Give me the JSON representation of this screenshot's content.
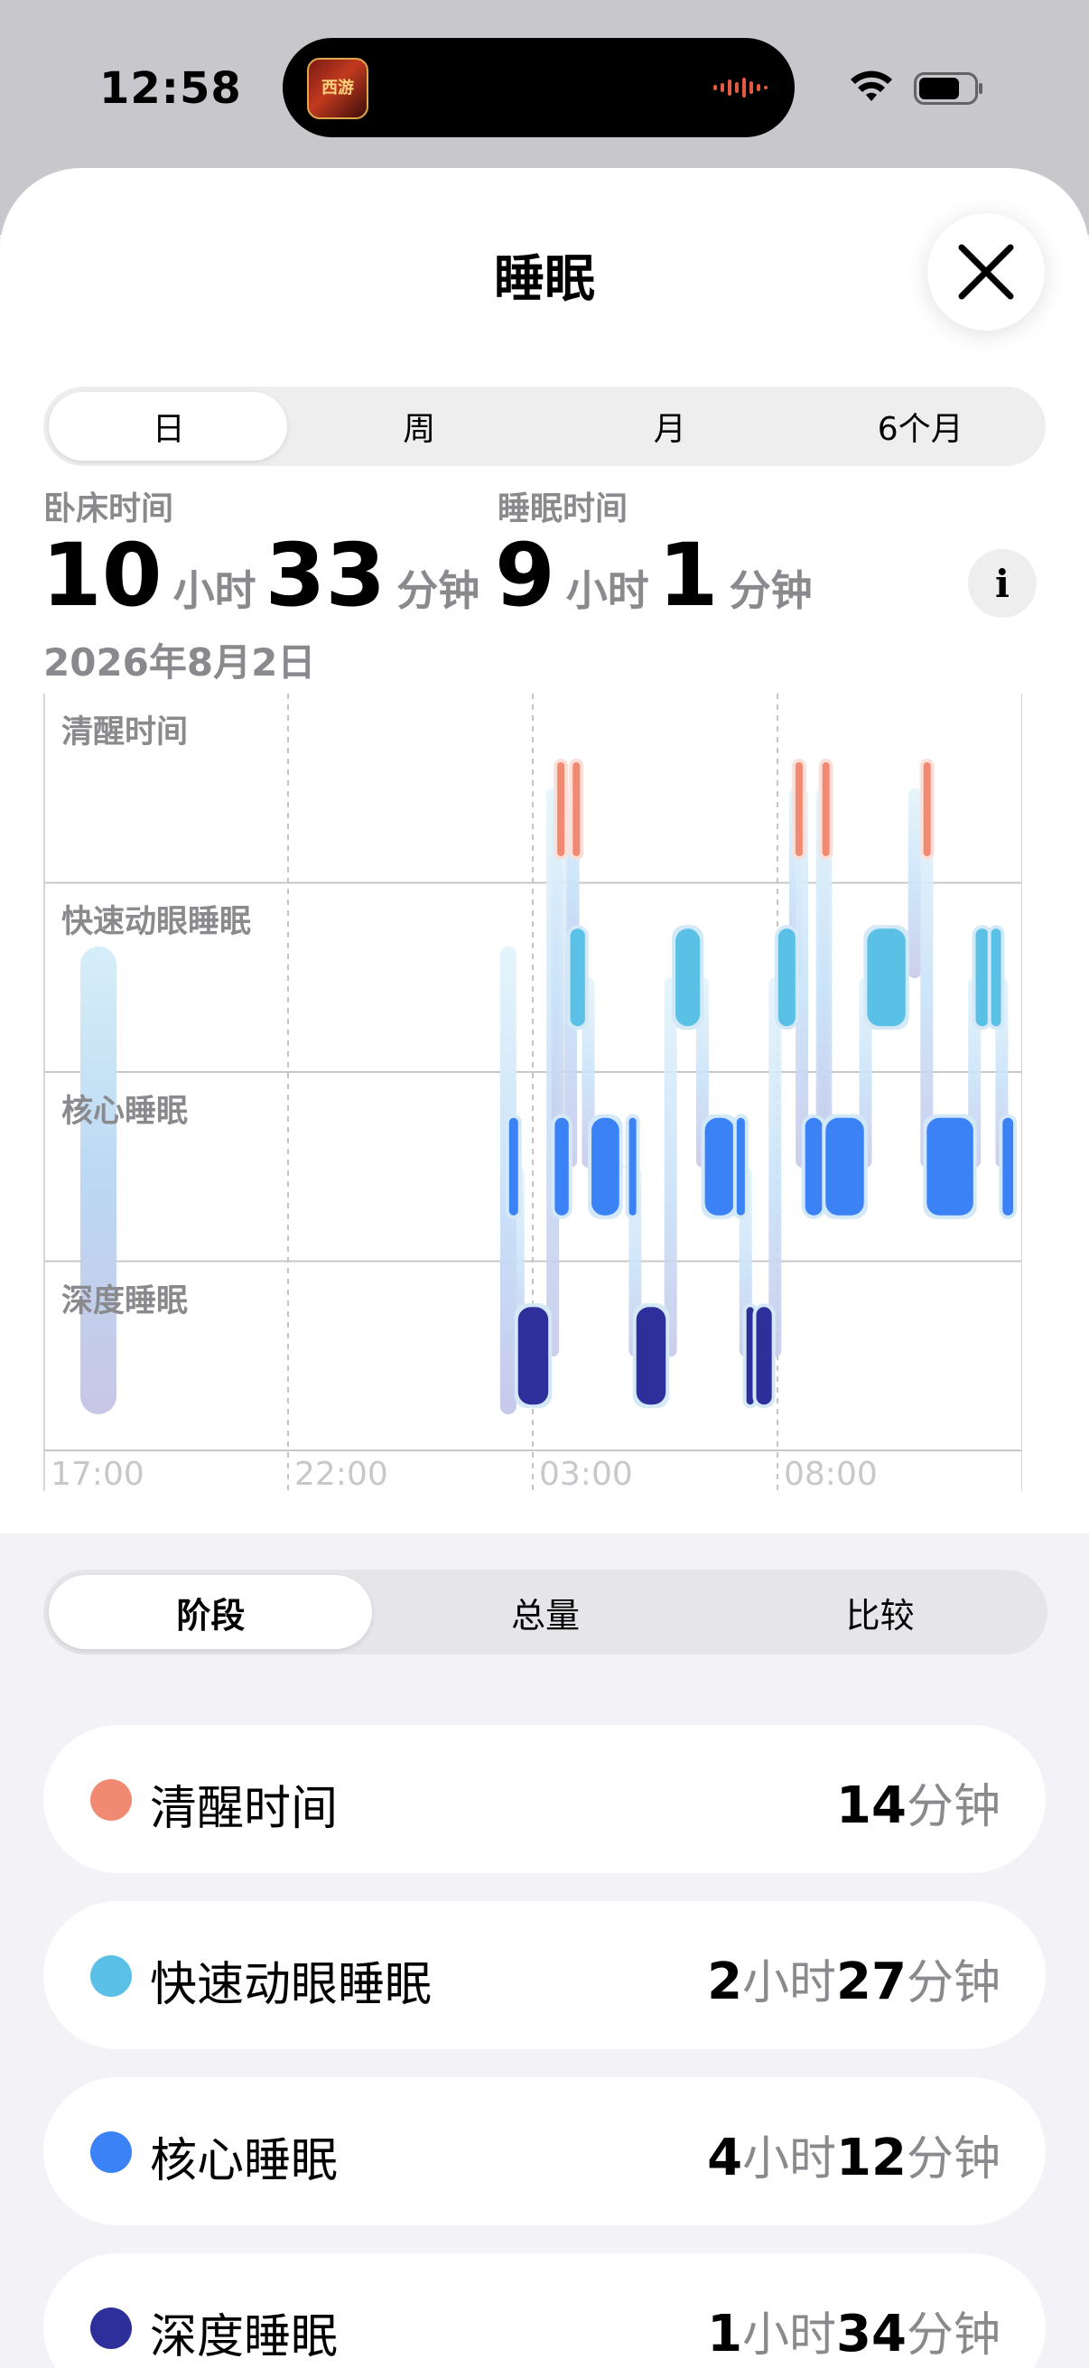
{
  "status_bar": {
    "time": "12:58"
  },
  "island": {
    "app_icon_text": "西游",
    "icon": "audio-waveform-icon"
  },
  "header": {
    "title": "睡眠"
  },
  "range_tabs": [
    "日",
    "周",
    "月",
    "6个月"
  ],
  "summary": {
    "in_bed_label": "卧床时间",
    "in_bed_hours": "10",
    "in_bed_minutes": "33",
    "asleep_label": "睡眠时间",
    "asleep_hours": "9",
    "asleep_minutes": "1",
    "unit_hour": "小时",
    "unit_minute": "分钟",
    "date": "2026年8月2日",
    "info_label": "i"
  },
  "chart_data": {
    "type": "timeline",
    "stages": [
      "清醒时间",
      "快速动眼睡眠",
      "核心睡眠",
      "深度睡眠"
    ],
    "x_ticks": [
      "17:00",
      "22:00",
      "03:00",
      "08:00"
    ],
    "stage_colors": {
      "清醒时间": "#f08a72",
      "快速动眼睡眠": "#5ac0e6",
      "核心睡眠": "#3b82f6",
      "深度睡眠": "#2e2f9a"
    },
    "segments": [
      {
        "stage": "核心睡眠",
        "start": "02:31",
        "end": "02:42"
      },
      {
        "stage": "深度睡眠",
        "start": "02:42",
        "end": "03:19"
      },
      {
        "stage": "清醒时间",
        "start": "03:30",
        "end": "03:34"
      },
      {
        "stage": "核心睡眠",
        "start": "03:27",
        "end": "03:44"
      },
      {
        "stage": "清醒时间",
        "start": "03:49",
        "end": "03:53"
      },
      {
        "stage": "快速动眼睡眠",
        "start": "03:46",
        "end": "04:04"
      },
      {
        "stage": "核心睡眠",
        "start": "04:12",
        "end": "04:46"
      },
      {
        "stage": "核心睡眠",
        "start": "04:58",
        "end": "05:04"
      },
      {
        "stage": "深度睡眠",
        "start": "05:07",
        "end": "05:43"
      },
      {
        "stage": "快速动眼睡眠",
        "start": "05:55",
        "end": "06:25"
      },
      {
        "stage": "核心睡眠",
        "start": "06:31",
        "end": "07:07"
      },
      {
        "stage": "核心睡眠",
        "start": "07:10",
        "end": "07:20"
      },
      {
        "stage": "深度睡眠",
        "start": "07:22",
        "end": "07:31"
      },
      {
        "stage": "深度睡眠",
        "start": "07:34",
        "end": "07:53"
      },
      {
        "stage": "快速动眼睡眠",
        "start": "08:01",
        "end": "08:22"
      },
      {
        "stage": "清醒时间",
        "start": "08:22",
        "end": "08:26"
      },
      {
        "stage": "核心睡眠",
        "start": "08:34",
        "end": "08:55"
      },
      {
        "stage": "清醒时间",
        "start": "08:55",
        "end": "08:59"
      },
      {
        "stage": "核心睡眠",
        "start": "08:59",
        "end": "09:46"
      },
      {
        "stage": "快速动眼睡眠",
        "start": "09:50",
        "end": "10:37"
      },
      {
        "stage": "清醒时间",
        "start": "10:59",
        "end": "11:03"
      },
      {
        "stage": "核心睡眠",
        "start": "11:03",
        "end": "12:00"
      },
      {
        "stage": "快速动眼睡眠",
        "start": "12:03",
        "end": "12:19"
      },
      {
        "stage": "快速动眼睡眠",
        "start": "12:22",
        "end": "12:34"
      },
      {
        "stage": "核心睡眠",
        "start": "12:36",
        "end": "12:49"
      }
    ]
  },
  "metric_tabs": [
    "阶段",
    "总量",
    "比较"
  ],
  "stage_rows": [
    {
      "name": "清醒时间",
      "color": "#f08a72",
      "h": "",
      "m": "14"
    },
    {
      "name": "快速动眼睡眠",
      "color": "#5ac0e6",
      "h": "2",
      "m": "27"
    },
    {
      "name": "核心睡眠",
      "color": "#3b82f6",
      "h": "4",
      "m": "12"
    },
    {
      "name": "深度睡眠",
      "color": "#2e2f9a",
      "h": "1",
      "m": "34"
    }
  ]
}
